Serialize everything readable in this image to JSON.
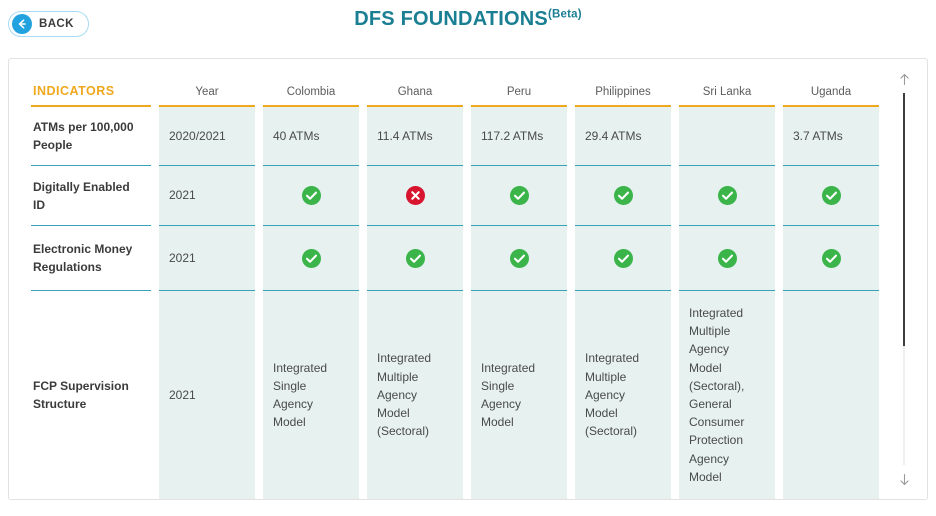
{
  "topbar": {
    "back_label": "BACK",
    "back_icon": "arrow-left-circle-icon",
    "title": "DFS FOUNDATIONS",
    "title_suffix": "(Beta)"
  },
  "colors": {
    "title": "#1a7f93",
    "accent_orange": "#f0a81e",
    "accent_teal": "#35a3b5",
    "cell_bg": "#e6f1f0",
    "status_yes": "#3bb44a",
    "status_no": "#d8152f",
    "back_blue": "#22a3e0"
  },
  "table": {
    "headers": [
      "INDICATORS",
      "Year",
      "Colombia",
      "Ghana",
      "Peru",
      "Philippines",
      "Sri Lanka",
      "Uganda"
    ],
    "rows": [
      {
        "indicator": "ATMs per 100,000 People",
        "year": "2020/2021",
        "cells": [
          {
            "type": "text",
            "value": "40 ATMs"
          },
          {
            "type": "text",
            "value": "11.4 ATMs"
          },
          {
            "type": "text",
            "value": "117.2 ATMs"
          },
          {
            "type": "text",
            "value": "29.4 ATMs"
          },
          {
            "type": "text",
            "value": ""
          },
          {
            "type": "text",
            "value": "3.7 ATMs"
          }
        ]
      },
      {
        "indicator": "Digitally Enabled ID",
        "year": "2021",
        "cells": [
          {
            "type": "status",
            "value": "yes"
          },
          {
            "type": "status",
            "value": "no"
          },
          {
            "type": "status",
            "value": "yes"
          },
          {
            "type": "status",
            "value": "yes"
          },
          {
            "type": "status",
            "value": "yes"
          },
          {
            "type": "status",
            "value": "yes"
          }
        ]
      },
      {
        "indicator": "Electronic Money Regulations",
        "year": "2021",
        "cells": [
          {
            "type": "status",
            "value": "yes"
          },
          {
            "type": "status",
            "value": "yes"
          },
          {
            "type": "status",
            "value": "yes"
          },
          {
            "type": "status",
            "value": "yes"
          },
          {
            "type": "status",
            "value": "yes"
          },
          {
            "type": "status",
            "value": "yes"
          }
        ]
      },
      {
        "indicator": "FCP Supervision Structure",
        "year": "2021",
        "cells": [
          {
            "type": "text",
            "value": "Integrated Single Agency Model"
          },
          {
            "type": "text",
            "value": "Integrated Multiple Agency Model (Sectoral)"
          },
          {
            "type": "text",
            "value": "Integrated Single Agency Model"
          },
          {
            "type": "text",
            "value": "Integrated Multiple Agency Model (Sectoral)"
          },
          {
            "type": "text",
            "value": "Integrated Multiple Agency Model (Sectoral), General Consumer Protection Agency Model"
          },
          {
            "type": "text",
            "value": ""
          }
        ]
      }
    ]
  },
  "scrollbar": {
    "up_icon": "arrow-up-icon",
    "down_icon": "arrow-down-icon",
    "thumb_percent": 68
  }
}
